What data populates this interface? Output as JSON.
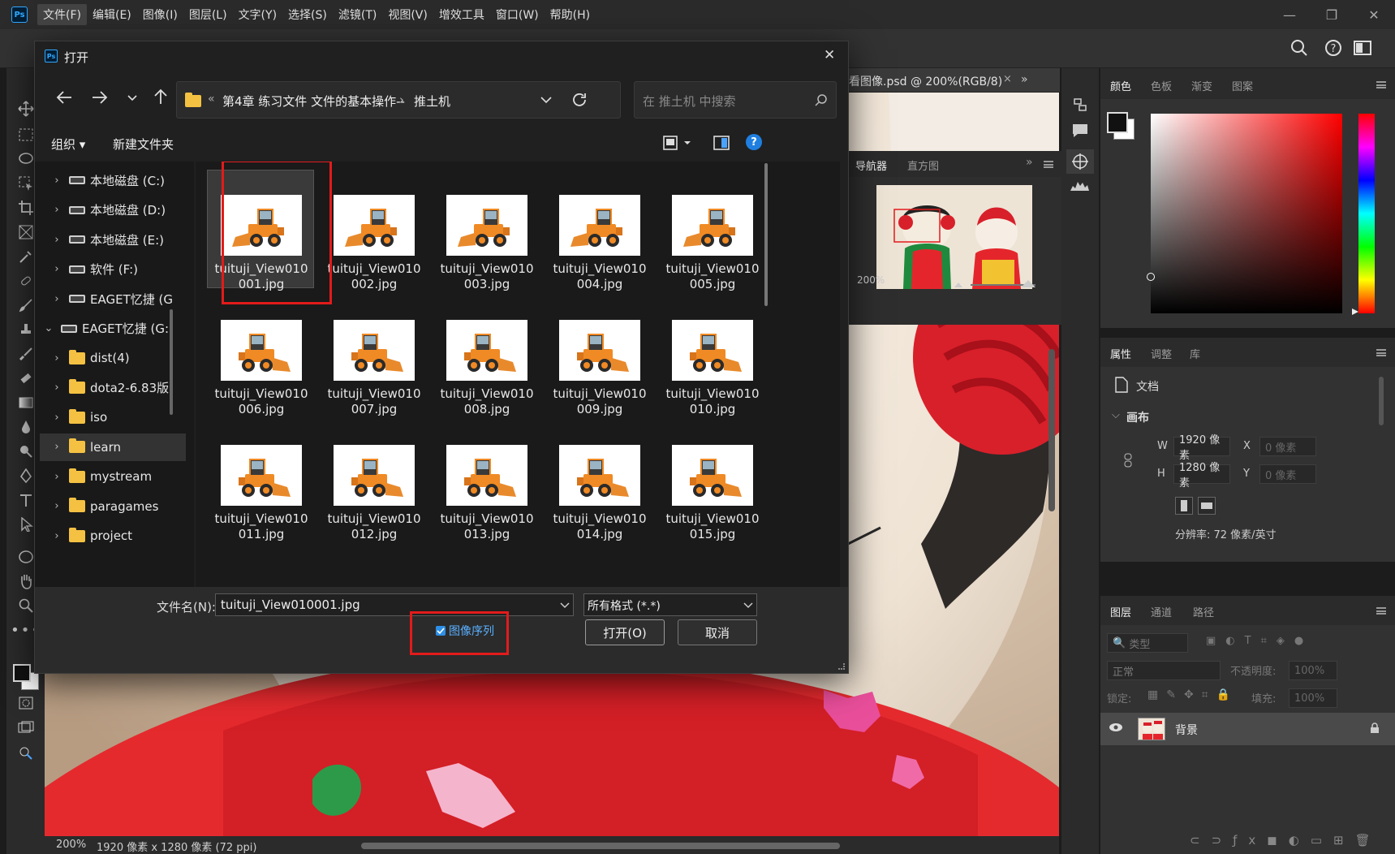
{
  "app": {
    "menu": [
      "文件(F)",
      "编辑(E)",
      "图像(I)",
      "图层(L)",
      "文字(Y)",
      "选择(S)",
      "滤镜(T)",
      "视图(V)",
      "增效工具",
      "窗口(W)",
      "帮助(H)"
    ]
  },
  "doc_tab": {
    "title": "看图像.psd @ 200%(RGB/8)",
    "close": "×"
  },
  "status": {
    "zoom": "200%",
    "info": "1920 像素 x 1280 像素 (72 ppi)"
  },
  "navigator": {
    "tabs": [
      "导航器",
      "直方图"
    ],
    "zoom": "200%"
  },
  "color_panel": {
    "tabs": [
      "颜色",
      "色板",
      "渐变",
      "图案"
    ]
  },
  "properties": {
    "tabs": [
      "属性",
      "调整",
      "库"
    ],
    "doc_label": "文档",
    "section": "画布",
    "w_label": "W",
    "w_value": "1920 像素",
    "h_label": "H",
    "h_value": "1280 像素",
    "x_label": "X",
    "x_value": "0 像素",
    "y_label": "Y",
    "y_value": "0 像素",
    "resolution": "分辨率: 72 像素/英寸"
  },
  "layers": {
    "tabs": [
      "图层",
      "通道",
      "路径"
    ],
    "filter_placeholder": "类型",
    "blend_mode": "正常",
    "opacity_label": "不透明度:",
    "opacity_value": "100%",
    "lock_label": "锁定:",
    "fill_label": "填充:",
    "fill_value": "100%",
    "layer_name": "背景"
  },
  "dialog": {
    "title": "打开",
    "close": "✕",
    "breadcrumb": {
      "prefix": "«",
      "folder": "第4章 练习文件 文件的基本操作--",
      "sep": "›",
      "current": "推土机"
    },
    "search_placeholder": "在 推土机 中搜索",
    "organize": "组织 ▾",
    "new_folder": "新建文件夹",
    "nav_items": [
      {
        "label": "本地磁盘 (C:)",
        "type": "drive"
      },
      {
        "label": "本地磁盘 (D:)",
        "type": "drive"
      },
      {
        "label": "本地磁盘 (E:)",
        "type": "drive"
      },
      {
        "label": "软件 (F:)",
        "type": "drive"
      },
      {
        "label": "EAGET忆捷 (G",
        "type": "drive"
      },
      {
        "label": "EAGET忆捷 (G:)",
        "type": "drive-open"
      },
      {
        "label": "dist(4)",
        "type": "folder"
      },
      {
        "label": "dota2-6.83版",
        "type": "folder"
      },
      {
        "label": "iso",
        "type": "folder"
      },
      {
        "label": "learn",
        "type": "folder"
      },
      {
        "label": "mystream",
        "type": "folder"
      },
      {
        "label": "paragames",
        "type": "folder"
      },
      {
        "label": "project",
        "type": "folder"
      }
    ],
    "files": [
      [
        "tuituji_View010",
        "001.jpg"
      ],
      [
        "tuituji_View010",
        "002.jpg"
      ],
      [
        "tuituji_View010",
        "003.jpg"
      ],
      [
        "tuituji_View010",
        "004.jpg"
      ],
      [
        "tuituji_View010",
        "005.jpg"
      ],
      [
        "tuituji_View010",
        "006.jpg"
      ],
      [
        "tuituji_View010",
        "007.jpg"
      ],
      [
        "tuituji_View010",
        "008.jpg"
      ],
      [
        "tuituji_View010",
        "009.jpg"
      ],
      [
        "tuituji_View010",
        "010.jpg"
      ],
      [
        "tuituji_View010",
        "011.jpg"
      ],
      [
        "tuituji_View010",
        "012.jpg"
      ],
      [
        "tuituji_View010",
        "013.jpg"
      ],
      [
        "tuituji_View010",
        "014.jpg"
      ],
      [
        "tuituji_View010",
        "015.jpg"
      ]
    ],
    "filename_label": "文件名(N):",
    "filename_value": "tuituji_View010001.jpg",
    "filter_value": "所有格式 (*.*)",
    "sequence_label": "图像序列",
    "sequence_checked": true,
    "open_label": "打开(O)",
    "cancel_label": "取消"
  }
}
